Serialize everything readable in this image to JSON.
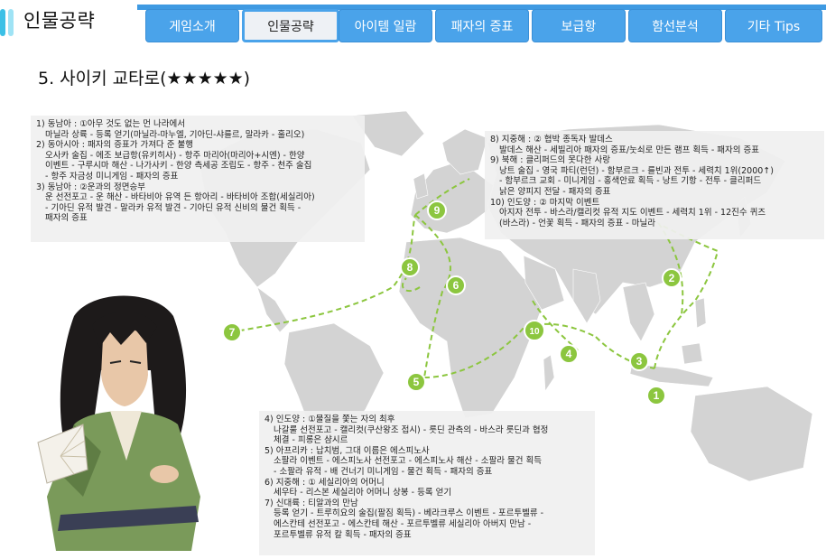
{
  "header": {
    "title": "인물공략",
    "tabs": [
      {
        "label": "게임소개",
        "active": false
      },
      {
        "label": "인물공략",
        "active": true
      },
      {
        "label": "아이템 일람",
        "active": false
      },
      {
        "label": "패자의 증표",
        "active": false
      },
      {
        "label": "보급항",
        "active": false
      },
      {
        "label": "함선분석",
        "active": false
      },
      {
        "label": "기타 Tips",
        "active": false
      }
    ]
  },
  "section": {
    "title": "5. 사이키 교타로(★★★★★)"
  },
  "map": {
    "markers": [
      "1",
      "2",
      "3",
      "4",
      "5",
      "6",
      "7",
      "8",
      "9",
      "10"
    ],
    "route_color": "#8cc63f",
    "marker_color": "#8cc63f",
    "land_color": "#cfcfcf"
  },
  "notes_left": [
    "1) 동남아 : ①아무 것도 없는 먼 나라에서",
    "마닐라 상륙 - 등록 얻기(마닐라-마누엘, 기아딘-샤를르, 말라카 - 훌리오)",
    "2) 동아시아 : 패자의 증표가 가져다 준 불행",
    "오사카 술집 - 에조 보급항(유키히사) - 항주 마리아(마리아+시엔) - 한양",
    "이벤트 - 구루시마 해산 - 나가사키 - 한양 측세공 조립도 - 항주 - 천주 술집",
    "- 항주 자금성 미니게임 - 패자의 증표",
    "3) 동남아 : ②운과의 정면승부",
    "운 선전포고 - 운 해산 - 바타비아 유역 든 항아리 - 바타비아 조합(세실리아)",
    "- 기아딘 유적 발견 - 말라카 유적 발견 - 기아딘 유적 신비의 물건 획득 -",
    "패자의 증표"
  ],
  "notes_right": [
    "8) 지중해 : ② 협박 종독자 발데스",
    "발데스 해산 - 세빌리아 패자의 증표/눗쇠로 만든 램프 획득 - 패자의 증표",
    "9) 북해 : 클리퍼드의 못다한 사랑",
    "낭트 술집 - 영국 파티(런던) - 함부르크 - 를빈과 전투 - 세력치 1위(2000↑)",
    "- 함부르크 교회 - 미니게임 - 홍색안료 획득 - 낭트 기항 - 전투 - 클리퍼드",
    "낡은 양피지 전달 - 패자의 증표",
    "10) 인도양 : ② 마지막 이벤트",
    "아지자 전투 - 바스라/캘리컷 유적 지도 이벤트 - 세력치 1위 - 12진수 퀴즈",
    "(바스라) - 언꽃 획득 - 패자의 증표 - 마닐라"
  ],
  "notes_bottom": [
    "4) 인도양 : ①물질을 쫓는 자의 최후",
    "나갈룰 선전포고 - 캘리컷(쿠산왕조 접시) - 릇딘 관측의 - 바스라 릇딘과 협정",
    "체결 - 피롱은 샴시르",
    "5) 아프리카 : 납치범, 그대 이름은 에스피노사",
    "소팔라 이벤트 - 에스피노사 선전포고 - 에스피노사 해산 - 소팔라 물건 획득",
    "- 소팔라 유적 - 배 건너기 미니게임 - 물건 획득 - 패자의 증표",
    "6) 지중해 : ① 세실리아의 어머니",
    "세우타 - 리스본 세실리아 어머니 상봉 - 등록 얻기",
    "7) 신대륙 : 티알과의 만남",
    "등록 얻기 - 트루히요의 술집(팔짐 획득) - 베라크루스 이벤트 - 포르투벨류 -",
    "에스칸테 선전포고 - 에스칸테 해산 - 포르투벨류 세실리아 아버지 만남 -",
    "포르투벨류 유적 칼 획득 - 패자의 증표"
  ]
}
